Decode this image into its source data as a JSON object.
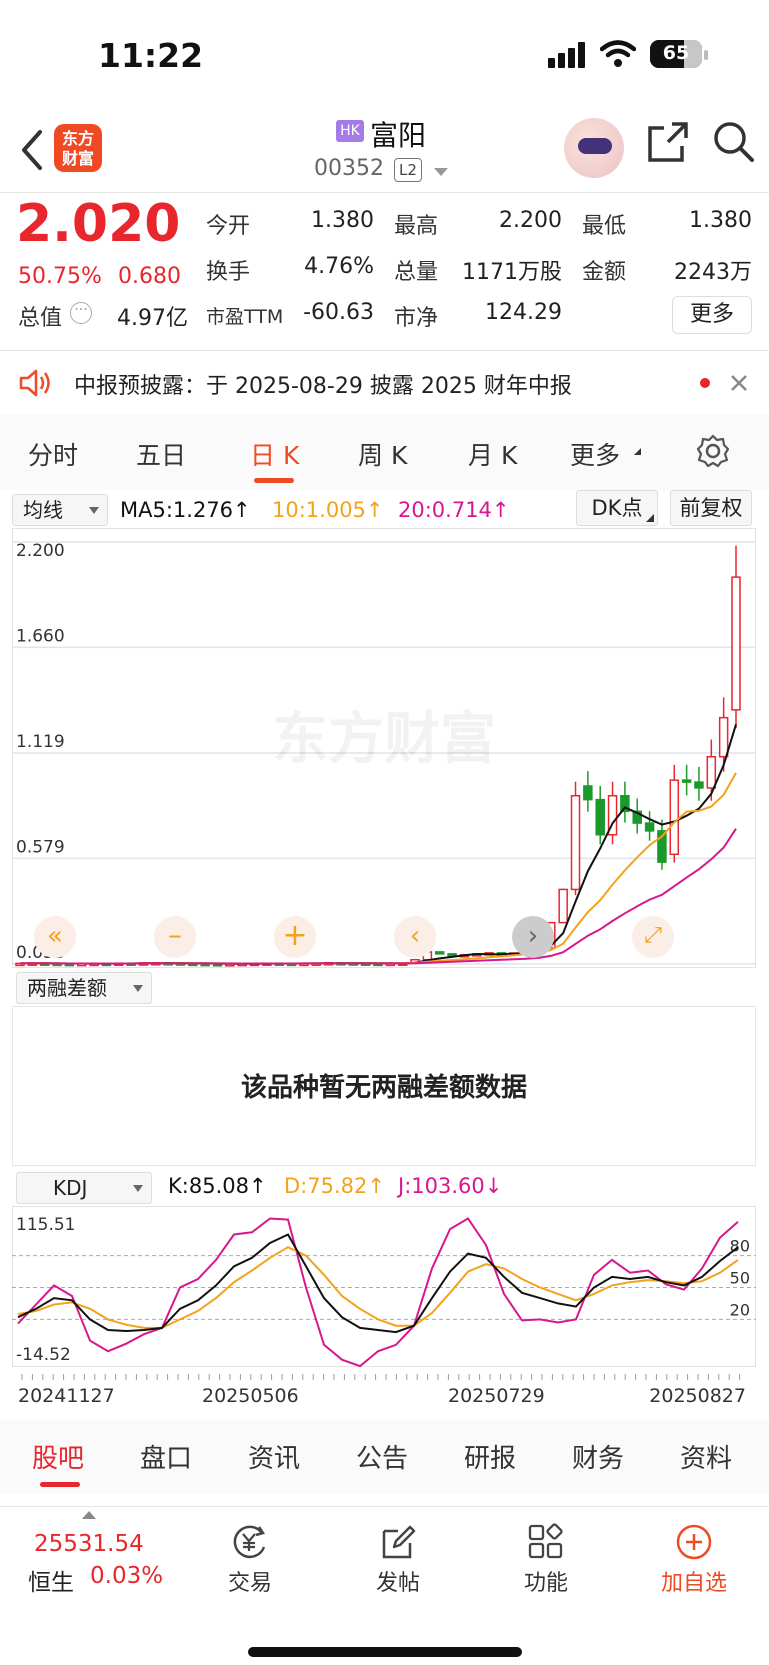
{
  "status_bar": {
    "time": "11:22",
    "battery": "65"
  },
  "header": {
    "market_badge": "HK",
    "stock_name": "富阳",
    "stock_code": "00352",
    "level_badge": "L2",
    "logo_text_line1": "东方",
    "logo_text_line2": "财富"
  },
  "quote": {
    "price": "2.020",
    "change_pct": "50.75%",
    "change_amt": "0.680",
    "rows": [
      [
        {
          "label": "今开",
          "value": "1.380",
          "color": "red"
        },
        {
          "label": "最高",
          "value": "2.200",
          "color": "red"
        },
        {
          "label": "最低",
          "value": "1.380",
          "color": "red"
        }
      ],
      [
        {
          "label": "换手",
          "value": "4.76%"
        },
        {
          "label": "总量",
          "value": "1171万股"
        },
        {
          "label": "金额",
          "value": "2243万"
        }
      ],
      [
        {
          "label": "总值",
          "value": "4.97亿"
        },
        {
          "label": "市盈TTM",
          "value": "-60.63"
        },
        {
          "label": "市净",
          "value": "124.29"
        }
      ]
    ],
    "more_label": "更多"
  },
  "notice": {
    "text": "中报预披露：于 2025-08-29 披露 2025 财年中报"
  },
  "period_tabs": [
    "分时",
    "五日",
    "日 K",
    "周 K",
    "月 K",
    "更多"
  ],
  "active_tab": "日 K",
  "chart_toolbar": {
    "indicator_select": "均线",
    "ma5": "MA5:1.276↑",
    "ma10": "10:1.005↑",
    "ma20": "20:0.714↑",
    "dk_button": "DK点",
    "adjust_button": "前复权"
  },
  "chart_data": [
    {
      "type": "candlestick",
      "title": "",
      "watermark": "东方财富",
      "y_tick_labels": [
        "2.200",
        "1.660",
        "1.119",
        "0.579",
        "0.038"
      ],
      "ylim": [
        0.038,
        2.2
      ],
      "candles": [
        {
          "o": 0.04,
          "c": 0.041
        },
        {
          "o": 0.041,
          "c": 0.042
        },
        {
          "o": 0.042,
          "c": 0.041
        },
        {
          "o": 0.041,
          "c": 0.04
        },
        {
          "o": 0.04,
          "c": 0.039
        },
        {
          "o": 0.039,
          "c": 0.04
        },
        {
          "o": 0.04,
          "c": 0.041
        },
        {
          "o": 0.041,
          "c": 0.04
        },
        {
          "o": 0.04,
          "c": 0.042
        },
        {
          "o": 0.042,
          "c": 0.041
        },
        {
          "o": 0.041,
          "c": 0.043
        },
        {
          "o": 0.043,
          "c": 0.044
        },
        {
          "o": 0.044,
          "c": 0.043
        },
        {
          "o": 0.043,
          "c": 0.041
        },
        {
          "o": 0.041,
          "c": 0.04
        },
        {
          "o": 0.04,
          "c": 0.039
        },
        {
          "o": 0.039,
          "c": 0.038
        },
        {
          "o": 0.038,
          "c": 0.039
        },
        {
          "o": 0.039,
          "c": 0.04
        },
        {
          "o": 0.04,
          "c": 0.041
        },
        {
          "o": 0.041,
          "c": 0.042
        },
        {
          "o": 0.042,
          "c": 0.041
        },
        {
          "o": 0.041,
          "c": 0.04
        },
        {
          "o": 0.04,
          "c": 0.041
        },
        {
          "o": 0.041,
          "c": 0.042
        },
        {
          "o": 0.042,
          "c": 0.044
        },
        {
          "o": 0.044,
          "c": 0.043
        },
        {
          "o": 0.043,
          "c": 0.042
        },
        {
          "o": 0.042,
          "c": 0.041
        },
        {
          "o": 0.041,
          "c": 0.04
        },
        {
          "o": 0.04,
          "c": 0.041
        },
        {
          "o": 0.041,
          "c": 0.042
        },
        {
          "o": 0.042,
          "c": 0.06
        },
        {
          "o": 0.06,
          "c": 0.1
        },
        {
          "o": 0.1,
          "c": 0.09
        },
        {
          "o": 0.09,
          "c": 0.08
        },
        {
          "o": 0.08,
          "c": 0.085
        },
        {
          "o": 0.085,
          "c": 0.09
        },
        {
          "o": 0.09,
          "c": 0.095
        },
        {
          "o": 0.095,
          "c": 0.092
        },
        {
          "o": 0.092,
          "c": 0.094
        },
        {
          "o": 0.094,
          "c": 0.098
        },
        {
          "o": 0.098,
          "c": 0.12
        },
        {
          "o": 0.12,
          "c": 0.25
        },
        {
          "o": 0.25,
          "c": 0.42
        },
        {
          "o": 0.42,
          "c": 0.9
        },
        {
          "o": 0.95,
          "c": 0.88
        },
        {
          "o": 0.88,
          "c": 0.7
        },
        {
          "o": 0.7,
          "c": 0.9
        },
        {
          "o": 0.9,
          "c": 0.82
        },
        {
          "o": 0.82,
          "c": 0.76
        },
        {
          "o": 0.76,
          "c": 0.72
        },
        {
          "o": 0.72,
          "c": 0.56
        },
        {
          "o": 0.6,
          "c": 0.98
        },
        {
          "o": 0.98,
          "c": 0.97
        },
        {
          "o": 0.97,
          "c": 0.94
        },
        {
          "o": 0.94,
          "c": 1.1
        },
        {
          "o": 1.1,
          "c": 1.3
        },
        {
          "o": 1.34,
          "c": 2.02
        }
      ],
      "ma_series": [
        {
          "name": "MA5",
          "color": "#111111"
        },
        {
          "name": "10",
          "color": "#f3a21b"
        },
        {
          "name": "20",
          "color": "#d8168e"
        }
      ]
    },
    {
      "type": "line",
      "title": "KDJ",
      "y_tick_labels": [
        "115.51",
        "-14.52"
      ],
      "ref_levels": [
        "80",
        "50",
        "20"
      ],
      "x_tick_labels": [
        "20241127",
        "20250506",
        "20250729",
        "20250827"
      ],
      "ylim": [
        -14.52,
        115.51
      ],
      "series": [
        {
          "name": "K",
          "color": "#111111",
          "values": [
            22,
            30,
            40,
            38,
            20,
            10,
            9,
            10,
            12,
            30,
            38,
            52,
            70,
            78,
            92,
            100,
            70,
            40,
            22,
            12,
            10,
            8,
            14,
            40,
            65,
            82,
            78,
            60,
            45,
            40,
            35,
            32,
            50,
            60,
            58,
            60,
            55,
            52,
            60,
            75,
            88
          ]
        },
        {
          "name": "D",
          "color": "#f3a21b",
          "values": [
            25,
            28,
            34,
            36,
            30,
            20,
            15,
            12,
            12,
            20,
            28,
            40,
            55,
            66,
            78,
            88,
            80,
            62,
            42,
            30,
            20,
            14,
            14,
            26,
            45,
            65,
            72,
            68,
            58,
            50,
            44,
            38,
            44,
            52,
            55,
            57,
            56,
            54,
            56,
            64,
            76
          ]
        },
        {
          "name": "J",
          "color": "#d8168e",
          "values": [
            16,
            34,
            52,
            42,
            0,
            -10,
            -3,
            6,
            12,
            50,
            58,
            76,
            100,
            102,
            115,
            114,
            50,
            -4,
            -18,
            -24,
            -10,
            -4,
            14,
            68,
            105,
            115,
            90,
            44,
            19,
            20,
            17,
            20,
            62,
            76,
            64,
            66,
            53,
            48,
            68,
            97,
            112
          ]
        }
      ]
    }
  ],
  "kdj_toolbar": {
    "select_label": "KDJ",
    "k": "K:85.08↑",
    "d": "D:75.82↑",
    "j": "J:103.60↓"
  },
  "margin_section": {
    "select_label": "两融差额",
    "empty_text": "该品种暂无两融差额数据"
  },
  "bottom_tabs": [
    "股吧",
    "盘口",
    "资讯",
    "公告",
    "研报",
    "财务",
    "资料"
  ],
  "footer": {
    "index_value": "25531.54",
    "index_name": "恒生",
    "index_change": "0.03%",
    "items": [
      "交易",
      "发帖",
      "功能",
      "加自选"
    ]
  },
  "colors": {
    "up": "#e8262e",
    "down": "#1a9a2b",
    "accent": "#f04a25"
  }
}
